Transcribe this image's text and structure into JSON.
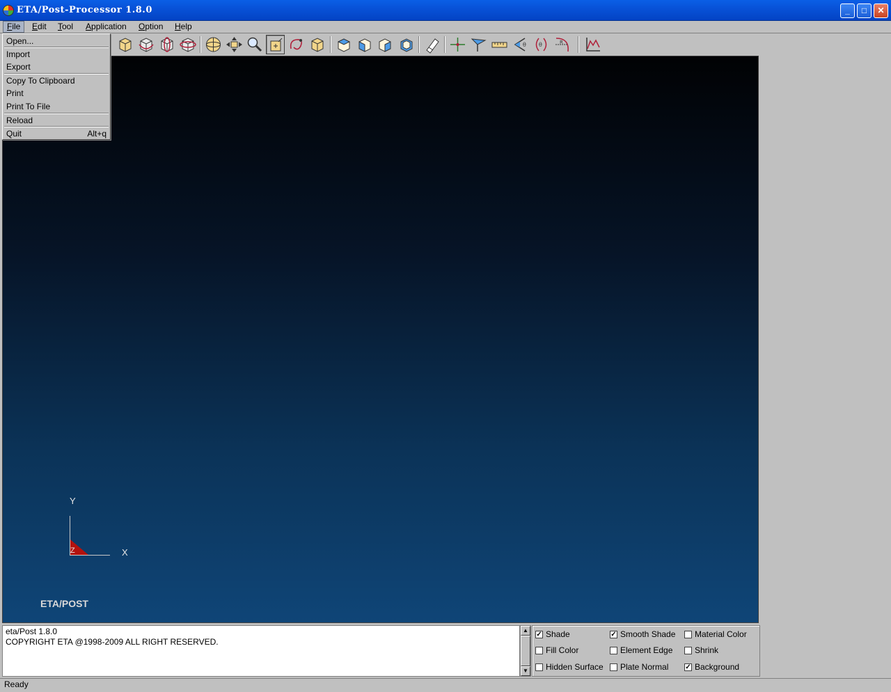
{
  "window": {
    "title": "ETA/Post-Processor 1.8.0",
    "minimize_glyph": "_",
    "maximize_glyph": "□",
    "close_glyph": "✕"
  },
  "menubar": {
    "items": [
      {
        "accel": "F",
        "rest": "ile"
      },
      {
        "accel": "E",
        "rest": "dit"
      },
      {
        "accel": "T",
        "rest": "ool"
      },
      {
        "accel": "A",
        "rest": "pplication"
      },
      {
        "accel": "O",
        "rest": "ption"
      },
      {
        "accel": "H",
        "rest": "elp"
      }
    ]
  },
  "file_menu": {
    "items": [
      {
        "label": "Open...",
        "shortcut": ""
      },
      {
        "label": "Import",
        "shortcut": ""
      },
      {
        "label": "Export",
        "shortcut": ""
      },
      {
        "label": "Copy To Clipboard",
        "shortcut": ""
      },
      {
        "label": "Print",
        "shortcut": ""
      },
      {
        "label": "Print To File",
        "shortcut": ""
      },
      {
        "label": "Reload",
        "shortcut": ""
      },
      {
        "label": "Quit",
        "shortcut": "Alt+q"
      }
    ]
  },
  "toolbar": {
    "icons": [
      "rotate-cube-icon",
      "rotate-cube-x-icon",
      "rotate-cube-y-icon",
      "rotate-cube-z-icon",
      "sphere-rotate-icon",
      "pan-arrows-icon",
      "zoom-magnifier-icon",
      "zoom-window-icon",
      "free-rotate-icon",
      "fit-view-icon",
      "view-top-icon",
      "view-front-icon",
      "view-side-icon",
      "view-iso-icon",
      "eraser-icon",
      "identify-point-icon",
      "select-node-icon",
      "measure-ruler-icon",
      "angle-icon",
      "angle-3pt-icon",
      "radius-icon",
      "curve-plot-icon"
    ]
  },
  "viewport": {
    "axis_y": "Y",
    "axis_x": "X",
    "axis_z": "Z",
    "watermark": "ETA/POST",
    "bg_top": "#010204",
    "bg_bottom": "#0f4577"
  },
  "console": {
    "lines": [
      "eta/Post 1.8.0",
      "COPYRIGHT ETA @1998-2009 ALL RIGHT RESERVED."
    ]
  },
  "options": [
    {
      "label": "Shade",
      "checked": true
    },
    {
      "label": "Smooth Shade",
      "checked": true
    },
    {
      "label": "Material Color",
      "checked": false
    },
    {
      "label": "Fill Color",
      "checked": false
    },
    {
      "label": "Element Edge",
      "checked": false
    },
    {
      "label": "Shrink",
      "checked": false
    },
    {
      "label": "Hidden Surface",
      "checked": false
    },
    {
      "label": "Plate Normal",
      "checked": false
    },
    {
      "label": "Background",
      "checked": true
    }
  ],
  "status": {
    "text": "Ready"
  }
}
